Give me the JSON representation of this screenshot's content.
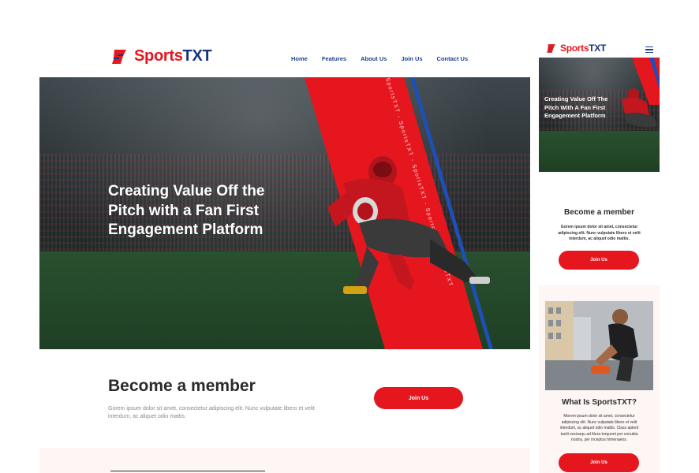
{
  "brand": {
    "part1": "Sports",
    "part2": "TXT"
  },
  "nav": [
    "Home",
    "Features",
    "About Us",
    "Join Us",
    "Contact Us"
  ],
  "hero": {
    "line1": "Creating Value Off the",
    "line2": "Pitch with a Fan First",
    "line3": "Engagement Platform",
    "stripe_text": "SportsTXT - SportsTXT - SportsTXT - SportsTXT - SportsTXT"
  },
  "member": {
    "title": "Become a member",
    "text_line1": "Gorem ipsum dolor sit amet, consectetur adipiscing elit. Nunc vulputate libero et velit",
    "text_line2": "interdum, ac aliquet odio mattis.",
    "button": "Join Us"
  },
  "mobile": {
    "hero_line1": "Creating Value Off The",
    "hero_line2": "Pitch With A Fan First",
    "hero_line3": "Engagement Platform",
    "member_title": "Become a member",
    "member_line1": "Gorem ipsum dolor sit amet, consectetur",
    "member_line2": "adipiscing elit. Nunc vulputate libero et velit",
    "member_line3": "interdum, ac aliquet odio mattis.",
    "member_button": "Join Us",
    "what_title": "What Is SportsTXT?",
    "what_line1": "Morem ipsum dolor sit amet, consectetur",
    "what_line2": "adipiscing elit. Nunc vulputate libero et velit",
    "what_line3": "interdum, ac aliquet odio mattis. Class aptent",
    "what_line4": "taciti sociosqu ad litora torquent per conubia",
    "what_line5": "nostra, per inceptos himenaeos.",
    "what_button": "Join Us"
  },
  "colors": {
    "red": "#e5161e",
    "navy": "#17347f",
    "blue": "#1e3e8c"
  },
  "icons": [
    "logo-mark-icon",
    "hamburger-menu-icon"
  ]
}
